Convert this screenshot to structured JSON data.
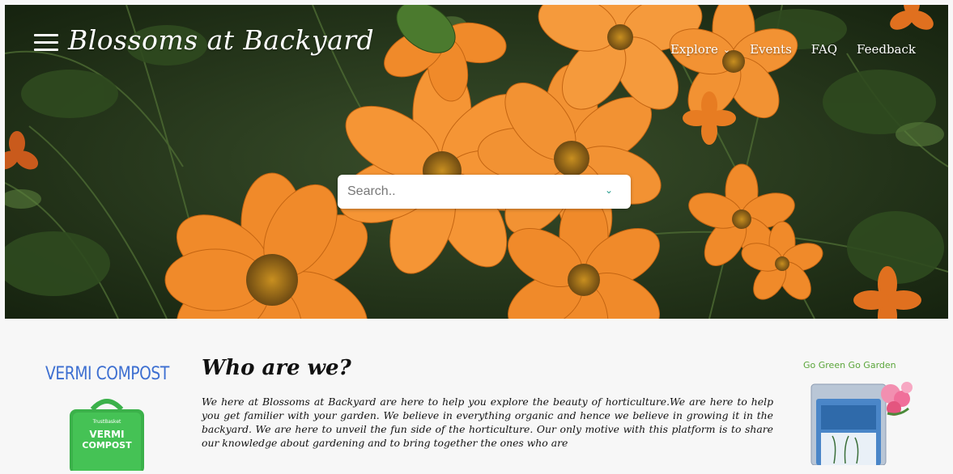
{
  "header": {
    "brand": "Blossoms at Backyard",
    "nav": [
      {
        "label": "Explore",
        "has_dropdown": true
      },
      {
        "label": "Events"
      },
      {
        "label": "FAQ"
      },
      {
        "label": "Feedback"
      }
    ]
  },
  "search": {
    "placeholder": "Search..",
    "value": ""
  },
  "main": {
    "heading": "Who are we?",
    "intro": "We here at Blossoms at Backyard are here to help you explore the beauty of horticulture.We are here to help you get familier with your garden. We believe in everything organic and hence we believe in growing it in the backyard. We are here to unveil the fun side of the horticulture. Our only motive with this platform is to share our knowledge about gardening and to bring together the ones who are"
  },
  "left_ad": {
    "title": "VERMI COMPOST",
    "bag_brand": "TrustBasket",
    "bag_line1": "VERMI",
    "bag_line2": "COMPOST"
  },
  "right_ad": {
    "title": "Go Green Go Garden"
  },
  "icons": {
    "menu": "hamburger-menu-icon",
    "dropdown": "chevron-down-icon"
  },
  "colors": {
    "ad_title_blue": "#3d6fd1",
    "ad_title_green": "#5aa53a",
    "flower_orange": "#f08a2a",
    "chevron_teal": "#2a9d8f"
  }
}
